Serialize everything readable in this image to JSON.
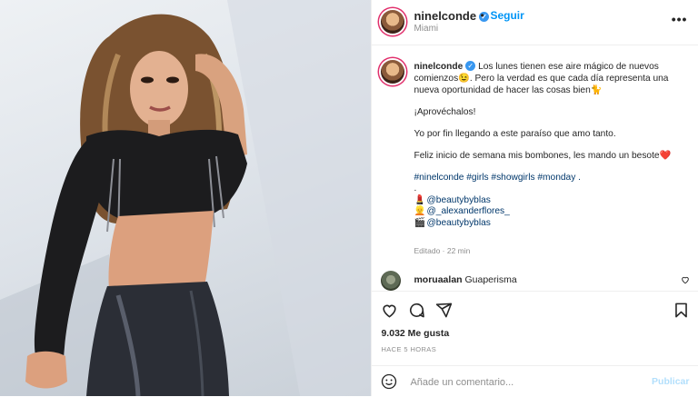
{
  "post": {
    "header": {
      "username": "ninelconde",
      "dot": "•",
      "follow_label": "Seguir",
      "location": "Miami",
      "more_label": "•••"
    },
    "caption": {
      "username": "ninelconde",
      "text_1": "Los lunes tienen ese aire mágico de nuevos comienzos😉. Pero la verdad es que cada día representa una nueva oportunidad de hacer las cosas bien🐈",
      "text_2": "¡Aprovéchalos!",
      "text_3": "Yo por fin llegando a este paraíso que amo tanto.",
      "text_4": "Feliz inicio de semana mis bombones, les mando un besote❤️",
      "hashtags": "#ninelconde #girls #showgirls #monday .",
      "separator": ".",
      "credits": [
        {
          "emoji": "💄",
          "handle": "@beautybyblas"
        },
        {
          "emoji": "👱",
          "handle": "@_alexanderflores_"
        },
        {
          "emoji": "🎬",
          "handle": "@beautybyblas"
        }
      ],
      "edited": "Editado · 22 min"
    },
    "comment": {
      "username": "moruaalan",
      "text": "Guaperisma"
    },
    "likes": "9.032 Me gusta",
    "timestamp": "HACE 5 HORAS",
    "add_comment": {
      "placeholder": "Añade un comentario...",
      "publish_label": "Publicar"
    }
  },
  "colors": {
    "link_blue": "#0095f6",
    "hashtag_blue": "#00376b",
    "verified_blue": "#3897f0",
    "muted_text": "#8e8e8e",
    "publish_disabled": "#b2dffc"
  },
  "icons": [
    "heart-icon",
    "comment-icon",
    "share-icon",
    "bookmark-icon",
    "emoji-icon",
    "verified-badge-icon",
    "more-options-icon"
  ]
}
